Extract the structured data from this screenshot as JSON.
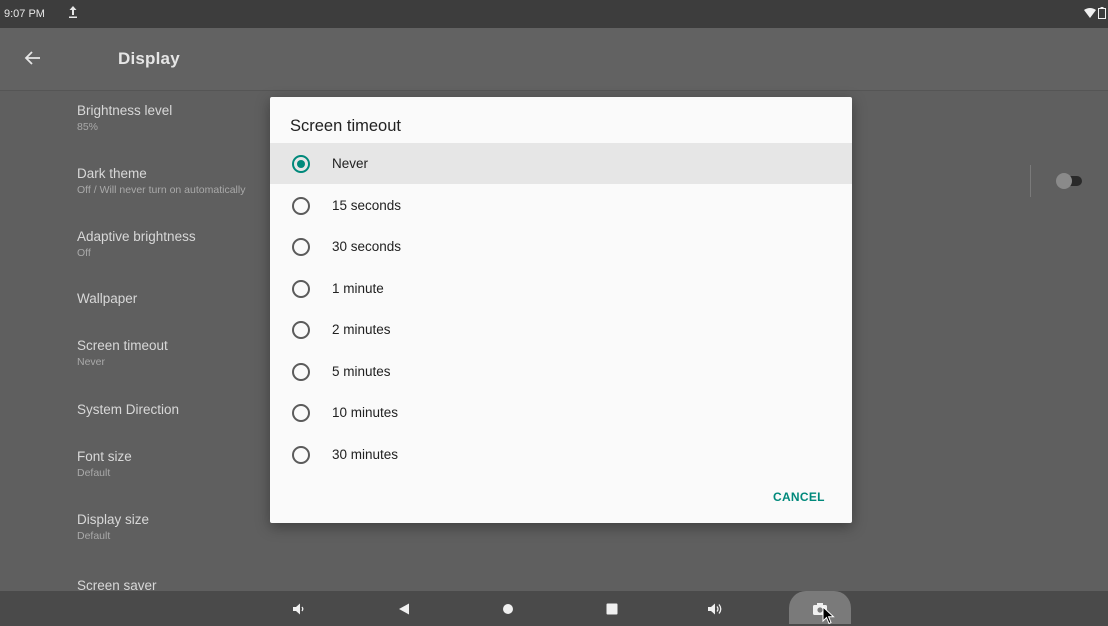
{
  "status_bar": {
    "time": "9:07 PM"
  },
  "app_bar": {
    "title": "Display"
  },
  "settings": [
    {
      "title": "Brightness level",
      "summary": "85%"
    },
    {
      "title": "Dark theme",
      "summary": "Off / Will never turn on automatically"
    },
    {
      "title": "Adaptive brightness",
      "summary": "Off"
    },
    {
      "title": "Wallpaper",
      "summary": ""
    },
    {
      "title": "Screen timeout",
      "summary": "Never"
    },
    {
      "title": "System Direction",
      "summary": ""
    },
    {
      "title": "Font size",
      "summary": "Default"
    },
    {
      "title": "Display size",
      "summary": "Default"
    },
    {
      "title": "Screen saver",
      "summary": ""
    }
  ],
  "dark_theme_toggle": {
    "state": "off"
  },
  "dialog": {
    "title": "Screen timeout",
    "options": [
      {
        "label": "Never",
        "selected": true
      },
      {
        "label": "15 seconds",
        "selected": false
      },
      {
        "label": "30 seconds",
        "selected": false
      },
      {
        "label": "1 minute",
        "selected": false
      },
      {
        "label": "2 minutes",
        "selected": false
      },
      {
        "label": "5 minutes",
        "selected": false
      },
      {
        "label": "10 minutes",
        "selected": false
      },
      {
        "label": "30 minutes",
        "selected": false
      }
    ],
    "cancel_label": "CANCEL"
  },
  "nav_bar": {
    "icons": [
      "volume-down-icon",
      "back-icon",
      "home-icon",
      "recents-icon",
      "volume-up-icon",
      "screenshot-icon"
    ]
  },
  "colors": {
    "accent": "#00897b",
    "dialog_bg": "#fafafa",
    "scrim": "#5f5f5f"
  }
}
